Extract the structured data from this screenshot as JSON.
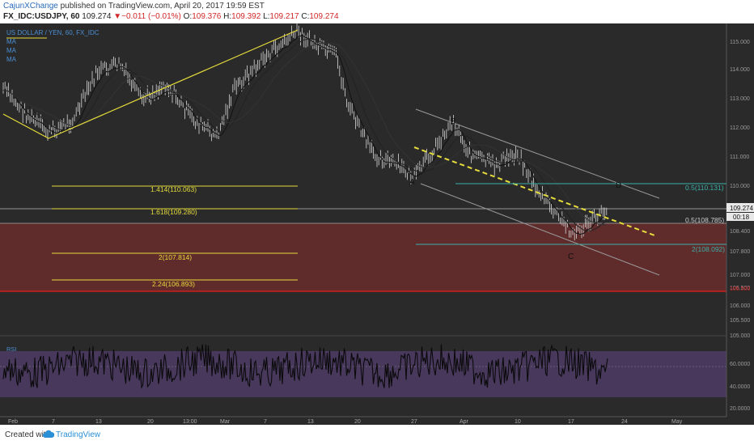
{
  "header": {
    "author": "CajunXChange",
    "published_text": "published on TradingView.com, April 20, 2017 19:59 EST",
    "symbol": "FX_IDC:USDJPY, 60",
    "last": "109.274",
    "change": "▼−0.011 (−0.01%)",
    "open_label": "O:",
    "open": "109.376",
    "high_label": "H:",
    "high": "109.392",
    "low_label": "L:",
    "low": "109.217",
    "close_label": "C:",
    "close": "109.274"
  },
  "legend": {
    "title": "US DOLLAR / YEN, 60, FX_IDC",
    "ma_labels": [
      "MA",
      "MA",
      "MA"
    ]
  },
  "price_axis": {
    "ticks": [
      "115.000",
      "114.000",
      "113.000",
      "112.000",
      "111.000",
      "110.000",
      "109.000",
      "108.400",
      "107.800",
      "107.000",
      "106.500",
      "106.000",
      "105.500",
      "105.000"
    ],
    "current_price": "109.274",
    "countdown": "00:18",
    "red_level": "106.500"
  },
  "time_axis": {
    "ticks": [
      "Feb",
      "7",
      "13",
      "20",
      "13:00",
      "Mar",
      "7",
      "13",
      "20",
      "27",
      "Apr",
      "10",
      "17",
      "24",
      "May"
    ]
  },
  "rsi": {
    "label": "RSI",
    "ticks": [
      "60.0000",
      "40.0000",
      "20.0000"
    ]
  },
  "annotations": {
    "wave_labels": [
      "A",
      "B",
      "C",
      "D"
    ],
    "fib_left": [
      "1.414(110.063)",
      "1.618(109.280)",
      "2(107.814)",
      "2.24(106.893)"
    ],
    "fib_right": [
      "0.5(110.131)",
      "0.5(108.785)",
      "2(108.092)"
    ]
  },
  "colors": {
    "background": "#2a2a2a",
    "candle": "#d8d8d8",
    "fib_yellow": "#e6dc3c",
    "teal": "#3ab0a8",
    "red_line": "#d11c1c",
    "red_zone": "#6a2b2b",
    "rsi_zone": "#4a3a62",
    "rsi_line": "#0a0a0a",
    "text_accent": "#4a8fd4"
  },
  "footer": {
    "created_with": "Created with",
    "brand": "TradingView"
  }
}
